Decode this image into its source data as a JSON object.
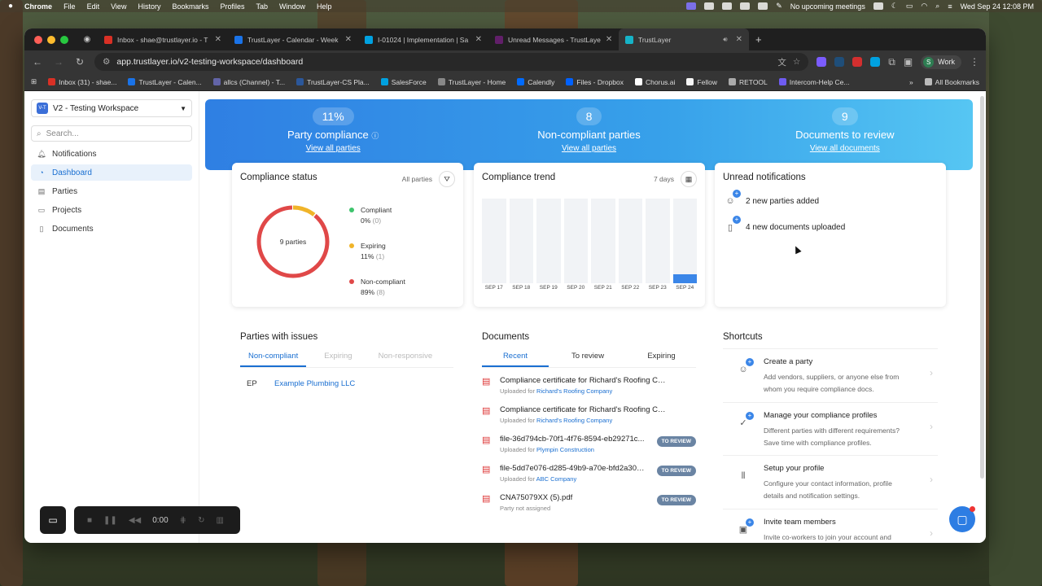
{
  "menubar": {
    "app": "Chrome",
    "items": [
      "File",
      "Edit",
      "View",
      "History",
      "Bookmarks",
      "Profiles",
      "Tab",
      "Window",
      "Help"
    ],
    "meetings": "No upcoming meetings",
    "datetime": "Wed Sep 24  12:08 PM"
  },
  "browser": {
    "tabs": [
      {
        "title": "Inbox - shae@trustlayer.io - T",
        "color": "#d93025"
      },
      {
        "title": "TrustLayer - Calendar - Week",
        "color": "#1a73e8"
      },
      {
        "title": "I-01024 | Implementation | Sa",
        "color": "#00a1e0"
      },
      {
        "title": "Unread Messages - TrustLaye",
        "color": "#611f69"
      },
      {
        "title": "TrustLayer",
        "color": "#16b3c7"
      }
    ],
    "url": "app.trustlayer.io/v2-testing-workspace/dashboard",
    "profile": "Work",
    "profile_initial": "S",
    "all_bookmarks": "All Bookmarks",
    "bookmarks": [
      {
        "label": "Inbox (31) - shae...",
        "color": "#d93025"
      },
      {
        "label": "TrustLayer - Calen...",
        "color": "#1a73e8"
      },
      {
        "label": "allcs (Channel) - T...",
        "color": "#6264a7"
      },
      {
        "label": "TrustLayer-CS Pla...",
        "color": "#2b579a"
      },
      {
        "label": "SalesForce",
        "color": "#00a1e0"
      },
      {
        "label": "TrustLayer - Home",
        "color": "#888888"
      },
      {
        "label": "Calendly",
        "color": "#006bff"
      },
      {
        "label": "Files - Dropbox",
        "color": "#0061fe"
      },
      {
        "label": "Chorus.ai",
        "color": "#ffffff"
      },
      {
        "label": "Fellow",
        "color": "#f5f5f5"
      },
      {
        "label": "RETOOL",
        "color": "#aaaaaa"
      },
      {
        "label": "Intercom-Help Ce...",
        "color": "#6f5cf1"
      }
    ]
  },
  "sidebar": {
    "workspace_logo": "V-T",
    "workspace": "V2 - Testing Workspace",
    "search_placeholder": "Search...",
    "items": [
      {
        "label": "Notifications",
        "icon": "bell-icon"
      },
      {
        "label": "Dashboard",
        "icon": "dashboard-icon"
      },
      {
        "label": "Parties",
        "icon": "parties-icon"
      },
      {
        "label": "Projects",
        "icon": "folder-icon"
      },
      {
        "label": "Documents",
        "icon": "document-icon"
      }
    ]
  },
  "hero": {
    "stats": [
      {
        "value": "11%",
        "label": "Party compliance",
        "link": "View all parties"
      },
      {
        "value": "8",
        "label": "Non-compliant parties",
        "link": "View all parties"
      },
      {
        "value": "9",
        "label": "Documents to review",
        "link": "View all documents"
      }
    ]
  },
  "compliance_status": {
    "title": "Compliance status",
    "filter": "All parties",
    "center_label": "9 parties",
    "legend": [
      {
        "label": "Compliant",
        "percent": "0%",
        "count": "(0)",
        "value": 0,
        "color": "#3ec46d"
      },
      {
        "label": "Expiring",
        "percent": "11%",
        "count": "(1)",
        "value": 1,
        "color": "#f0b429"
      },
      {
        "label": "Non-compliant",
        "percent": "89%",
        "count": "(8)",
        "value": 8,
        "color": "#e04848"
      }
    ]
  },
  "compliance_trend": {
    "title": "Compliance trend",
    "range": "7 days"
  },
  "chart_data": {
    "type": "bar",
    "categories": [
      "SEP 17",
      "SEP 18",
      "SEP 19",
      "SEP 20",
      "SEP 21",
      "SEP 22",
      "SEP 23",
      "SEP 24"
    ],
    "values": [
      0,
      0,
      0,
      0,
      0,
      0,
      0,
      11
    ],
    "ylim": [
      0,
      100
    ],
    "grid": false
  },
  "unread_notifications": {
    "title": "Unread notifications",
    "items": [
      {
        "text": "2 new parties added",
        "icon": "user-plus-icon"
      },
      {
        "text": "4 new documents uploaded",
        "icon": "document-plus-icon"
      }
    ]
  },
  "parties_with_issues": {
    "title": "Parties with issues",
    "tabs": [
      "Non-compliant",
      "Expiring",
      "Non-responsive"
    ],
    "rows": [
      {
        "initials": "EP",
        "name": "Example Plumbing LLC"
      }
    ]
  },
  "documents": {
    "title": "Documents",
    "tabs": [
      "Recent",
      "To review",
      "Expiring"
    ],
    "rows": [
      {
        "name": "Compliance certificate for Richard's Roofing Com...",
        "prefix": "Uploaded for",
        "party": "Richard's Roofing Company",
        "badge": ""
      },
      {
        "name": "Compliance certificate for Richard's Roofing Com...",
        "prefix": "Uploaded for",
        "party": "Richard's Roofing Company",
        "badge": ""
      },
      {
        "name": "file-36d794cb-70f1-4f76-8594-eb29271c...",
        "prefix": "Uploaded for",
        "party": "Plympin Construction",
        "badge": "TO REVIEW"
      },
      {
        "name": "file-5dd7e076-d285-49b9-a70e-bfd2a30d...",
        "prefix": "Uploaded for",
        "party": "ABC Company",
        "badge": "TO REVIEW"
      },
      {
        "name": "CNA75079XX (5).pdf",
        "prefix": "Party not assigned",
        "party": "",
        "badge": "TO REVIEW"
      }
    ]
  },
  "shortcuts": {
    "title": "Shortcuts",
    "items": [
      {
        "title": "Create a party",
        "desc1": "Add vendors, suppliers, or anyone else from",
        "desc2": "whom you require compliance docs."
      },
      {
        "title": "Manage your compliance profiles",
        "desc1": "Different parties with different requirements?",
        "desc2": "Save time with compliance profiles."
      },
      {
        "title": "Setup your profile",
        "desc1": "Configure your contact information, profile",
        "desc2": "details and notification settings."
      },
      {
        "title": "Invite team members",
        "desc1": "Invite co-workers to join your account and",
        "desc2": ""
      }
    ]
  },
  "recorder": {
    "time": "0:00"
  }
}
